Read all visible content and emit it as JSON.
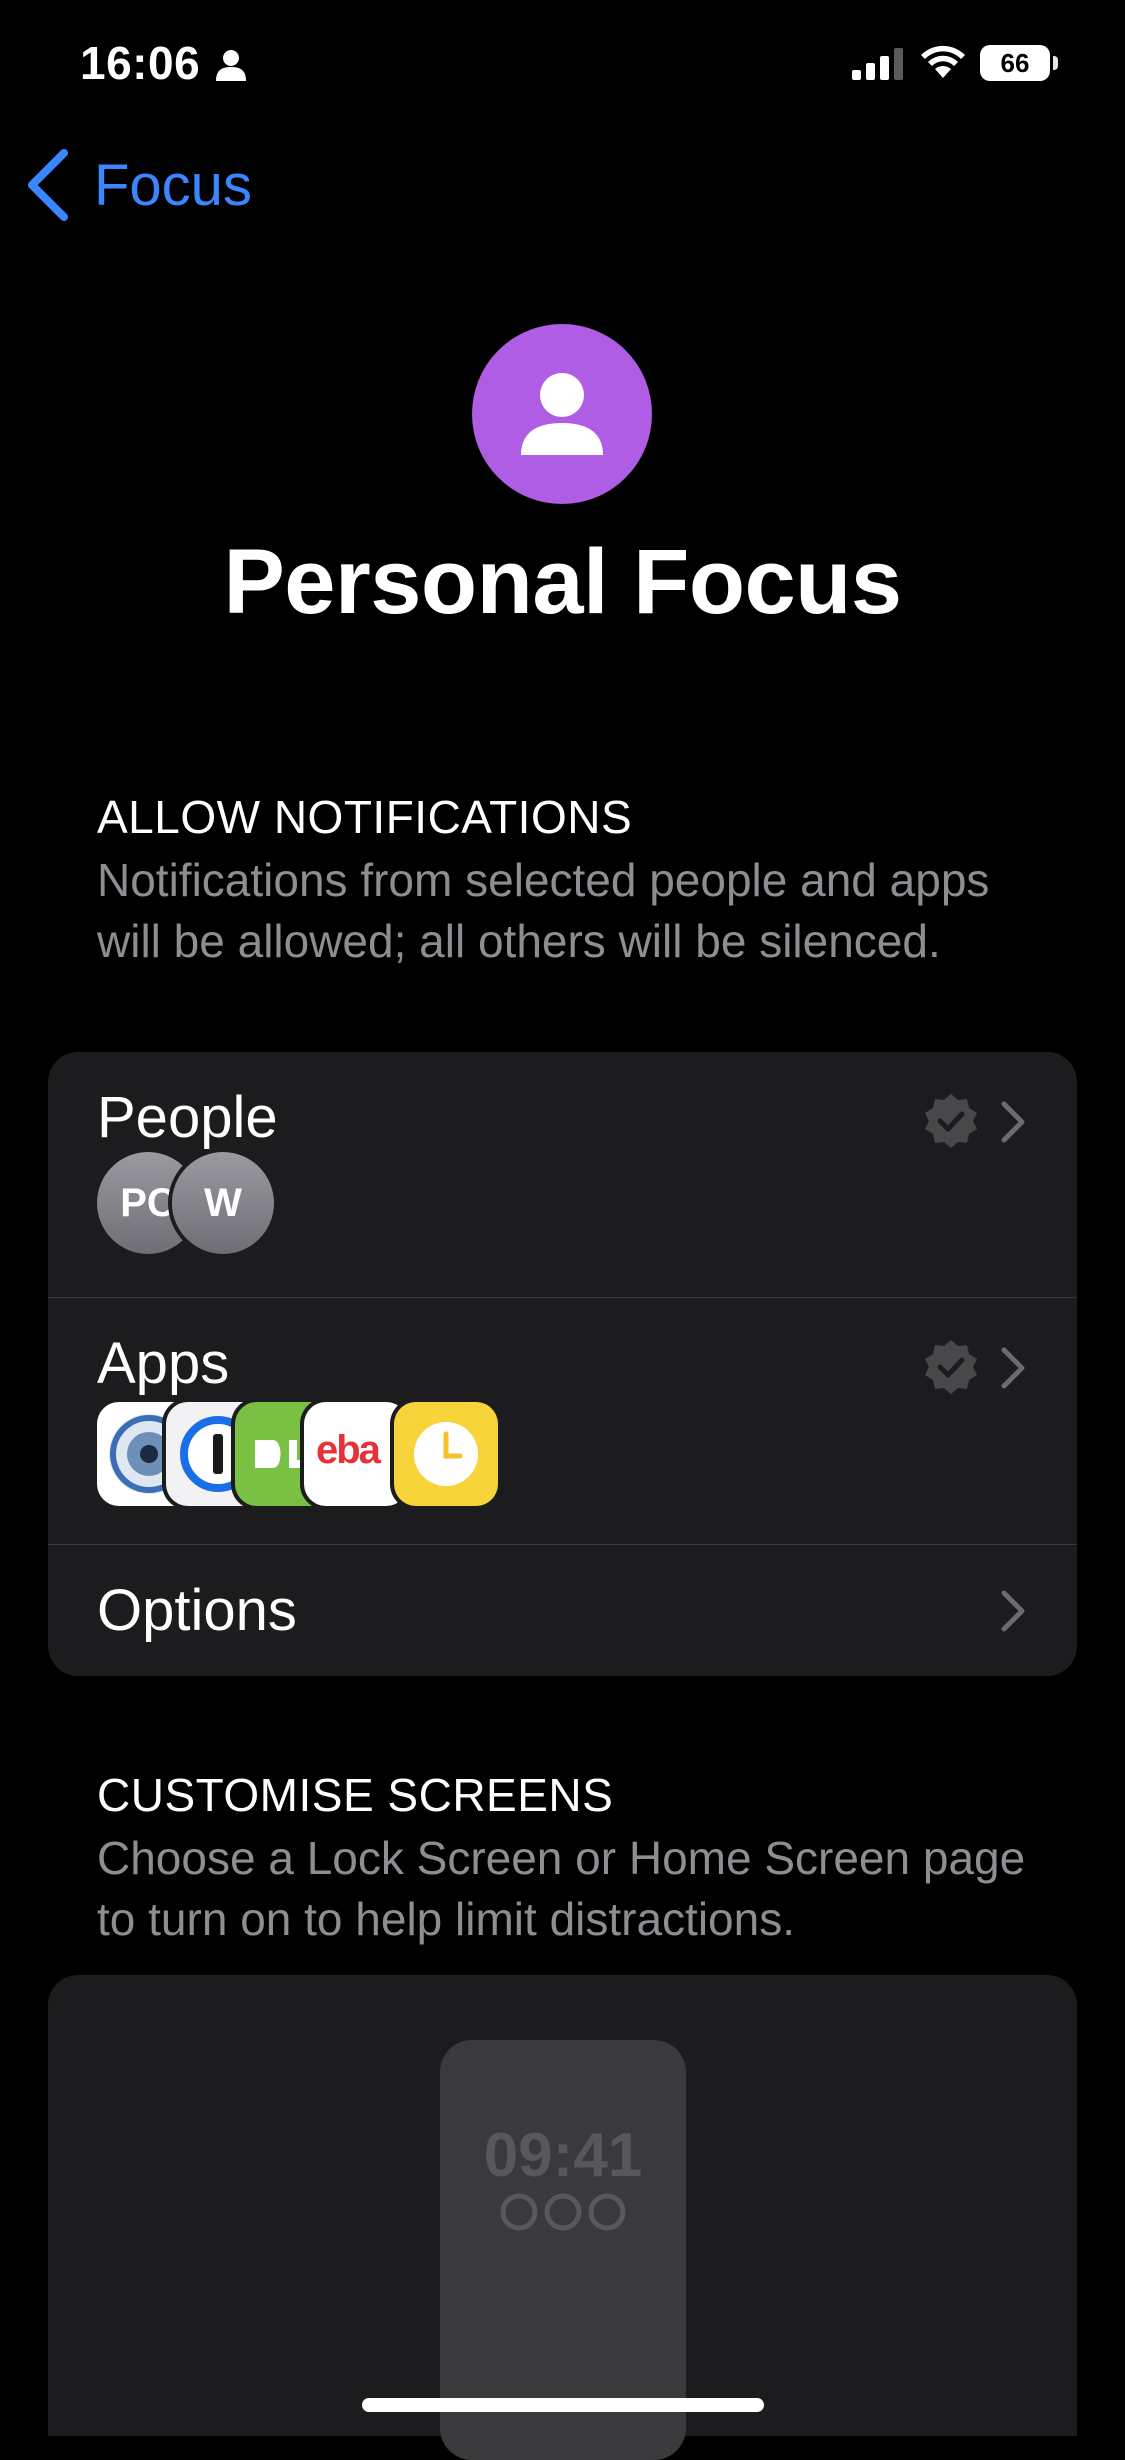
{
  "status_bar": {
    "time": "16:06",
    "battery": "66"
  },
  "nav": {
    "back_label": "Focus"
  },
  "header": {
    "title": "Personal Focus",
    "icon": "person-icon",
    "icon_color": "#b05de6"
  },
  "allow_notifications": {
    "heading": "ALLOW NOTIFICATIONS",
    "description": "Notifications from selected people and apps will be allowed; all others will be silenced.",
    "rows": {
      "people": {
        "label": "People",
        "avatars": [
          "PC",
          "W"
        ]
      },
      "apps": {
        "label": "Apps",
        "icons": [
          "iris-app-icon",
          "1password-app-icon",
          "duolingo-app-icon",
          "ebay-app-icon",
          "clock-app-icon"
        ],
        "ebay_text": "eba"
      },
      "options": {
        "label": "Options"
      }
    }
  },
  "customise_screens": {
    "heading": "CUSTOMISE SCREENS",
    "description": "Choose a Lock Screen or Home Screen page to turn on to help limit distractions.",
    "preview_time": "09:41"
  },
  "colors": {
    "accent": "#3a86ff",
    "card_bg": "#1c1c1e",
    "secondary_text": "#8d8d92"
  }
}
